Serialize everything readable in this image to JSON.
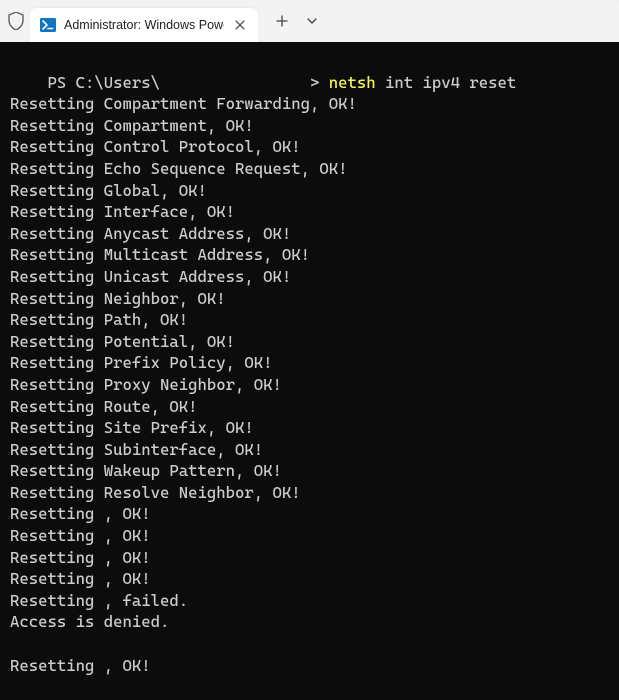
{
  "tab": {
    "title": "Administrator: Windows Powe"
  },
  "prompt": {
    "prefix": "PS C:\\Users\\",
    "suffix": "> ",
    "cmd_highlight": "netsh",
    "cmd_rest": " int ipv4 reset"
  },
  "output_lines": [
    "Resetting Compartment Forwarding, OK!",
    "Resetting Compartment, OK!",
    "Resetting Control Protocol, OK!",
    "Resetting Echo Sequence Request, OK!",
    "Resetting Global, OK!",
    "Resetting Interface, OK!",
    "Resetting Anycast Address, OK!",
    "Resetting Multicast Address, OK!",
    "Resetting Unicast Address, OK!",
    "Resetting Neighbor, OK!",
    "Resetting Path, OK!",
    "Resetting Potential, OK!",
    "Resetting Prefix Policy, OK!",
    "Resetting Proxy Neighbor, OK!",
    "Resetting Route, OK!",
    "Resetting Site Prefix, OK!",
    "Resetting Subinterface, OK!",
    "Resetting Wakeup Pattern, OK!",
    "Resetting Resolve Neighbor, OK!",
    "Resetting , OK!",
    "Resetting , OK!",
    "Resetting , OK!",
    "Resetting , OK!",
    "Resetting , failed.",
    "Access is denied.",
    "",
    "Resetting , OK!"
  ]
}
